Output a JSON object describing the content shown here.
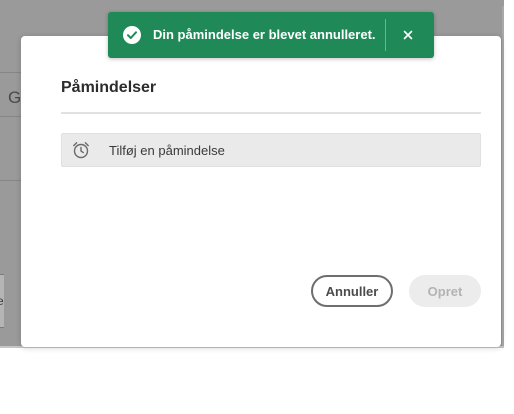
{
  "background": {
    "partial_tab_letter": "G",
    "partial_panel_letter": "e"
  },
  "dialog": {
    "title": "Påmindelser",
    "add_reminder_label": "Tilføj en påmindelse",
    "add_reminder_icon": "alarm-clock-icon",
    "cancel_label": "Annuller",
    "create_label": "Opret"
  },
  "toast": {
    "message": "Din påmindelse er blevet annulleret.",
    "status_icon": "checkmark-circle-icon",
    "close_icon": "close-icon",
    "color": "#1f8a58"
  }
}
